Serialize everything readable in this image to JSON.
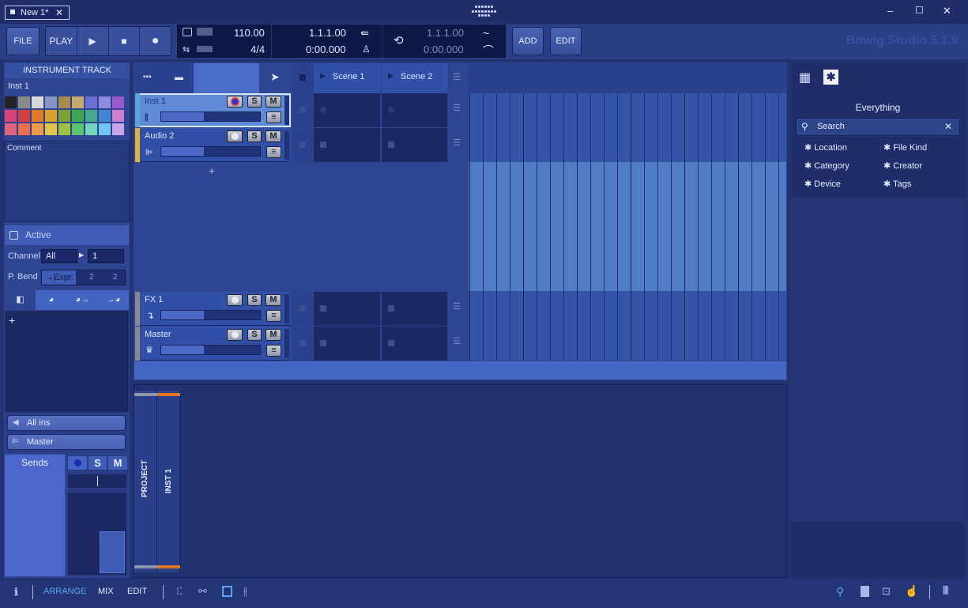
{
  "window": {
    "tab_title": "New 1*",
    "minimize": "–",
    "maximize": "☐",
    "close": "✕"
  },
  "toolbar": {
    "file": "FILE",
    "play": "PLAY",
    "tempo": "110.00",
    "signature": "4/4",
    "position": "1.1.1.00",
    "time": "0:00.000",
    "loop_start": "1.1.1.00",
    "loop_time": "0:00.000",
    "add": "ADD",
    "edit": "EDIT",
    "brand": "Bitwig Studio 5.1.9"
  },
  "inspector": {
    "header": "INSTRUMENT TRACK",
    "track_name": "Inst 1",
    "palette": [
      "#232323",
      "#8a8a8a",
      "#d7d7d7",
      "#8a93c6",
      "#a88a4c",
      "#c4a86e",
      "#6d6ed1",
      "#8b8ee0",
      "#9a58cf",
      "#d84575",
      "#d13f3f",
      "#e27b24",
      "#d9a22c",
      "#7fa12f",
      "#3da94a",
      "#48a88d",
      "#3f87d1",
      "#cf7fcf",
      "#e0637d",
      "#ea6f52",
      "#ee9a46",
      "#e1c449",
      "#9dc23f",
      "#58c36a",
      "#76d3c0",
      "#6fc4f0",
      "#c9a4e6"
    ],
    "comment_label": "Comment",
    "active_label": "Active",
    "channel_label": "Channel",
    "channel_value": "All",
    "channel_num": "1",
    "pbend_label": "P. Bend",
    "pbend_value": "→Expr.",
    "pbend_a": "2",
    "pbend_b": "2",
    "add": "+",
    "input": "All ins",
    "output": "Master",
    "sends": "Sends",
    "s": "S",
    "m": "M"
  },
  "arranger": {
    "scenes": [
      "Scene 1",
      "Scene 2"
    ],
    "add": "+",
    "tracks": [
      {
        "name": "Inst 1",
        "color": "#5aa5d8",
        "icon": "piano-icon"
      },
      {
        "name": "Audio 2",
        "color": "#e1b33c",
        "icon": "waveform-icon"
      },
      {
        "name": "FX 1",
        "color": "#8a8a8a",
        "icon": "fx-return-icon"
      },
      {
        "name": "Master",
        "color": "#8a8a8a",
        "icon": "crown-icon"
      }
    ],
    "s": "S",
    "m": "M"
  },
  "bottom": {
    "project_tab": "PROJECT",
    "inst_tab": "INST 1"
  },
  "browser": {
    "title": "Everything",
    "search_placeholder": "Search",
    "filters": [
      "Location",
      "File Kind",
      "Category",
      "Creator",
      "Device",
      "Tags"
    ]
  },
  "statusbar": {
    "arrange": "ARRANGE",
    "mix": "MIX",
    "edit": "EDIT"
  }
}
